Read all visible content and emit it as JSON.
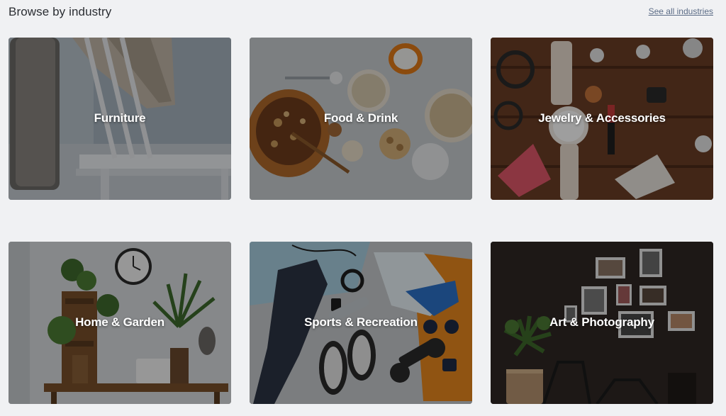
{
  "header": {
    "title": "Browse by industry",
    "see_all_label": "See all industries"
  },
  "industries": [
    {
      "label": "Furniture",
      "icon": "chair-photo"
    },
    {
      "label": "Food & Drink",
      "icon": "food-photo"
    },
    {
      "label": "Jewelry & Accessories",
      "icon": "watch-photo"
    },
    {
      "label": "Home & Garden",
      "icon": "houseplant-photo"
    },
    {
      "label": "Sports & Recreation",
      "icon": "sports-gear-photo"
    },
    {
      "label": "Art & Photography",
      "icon": "gallery-wall-photo"
    }
  ],
  "colors": {
    "background": "#f0f1f3",
    "title": "#2b2e33",
    "link": "#5b6c86",
    "card_label": "#ffffff"
  }
}
